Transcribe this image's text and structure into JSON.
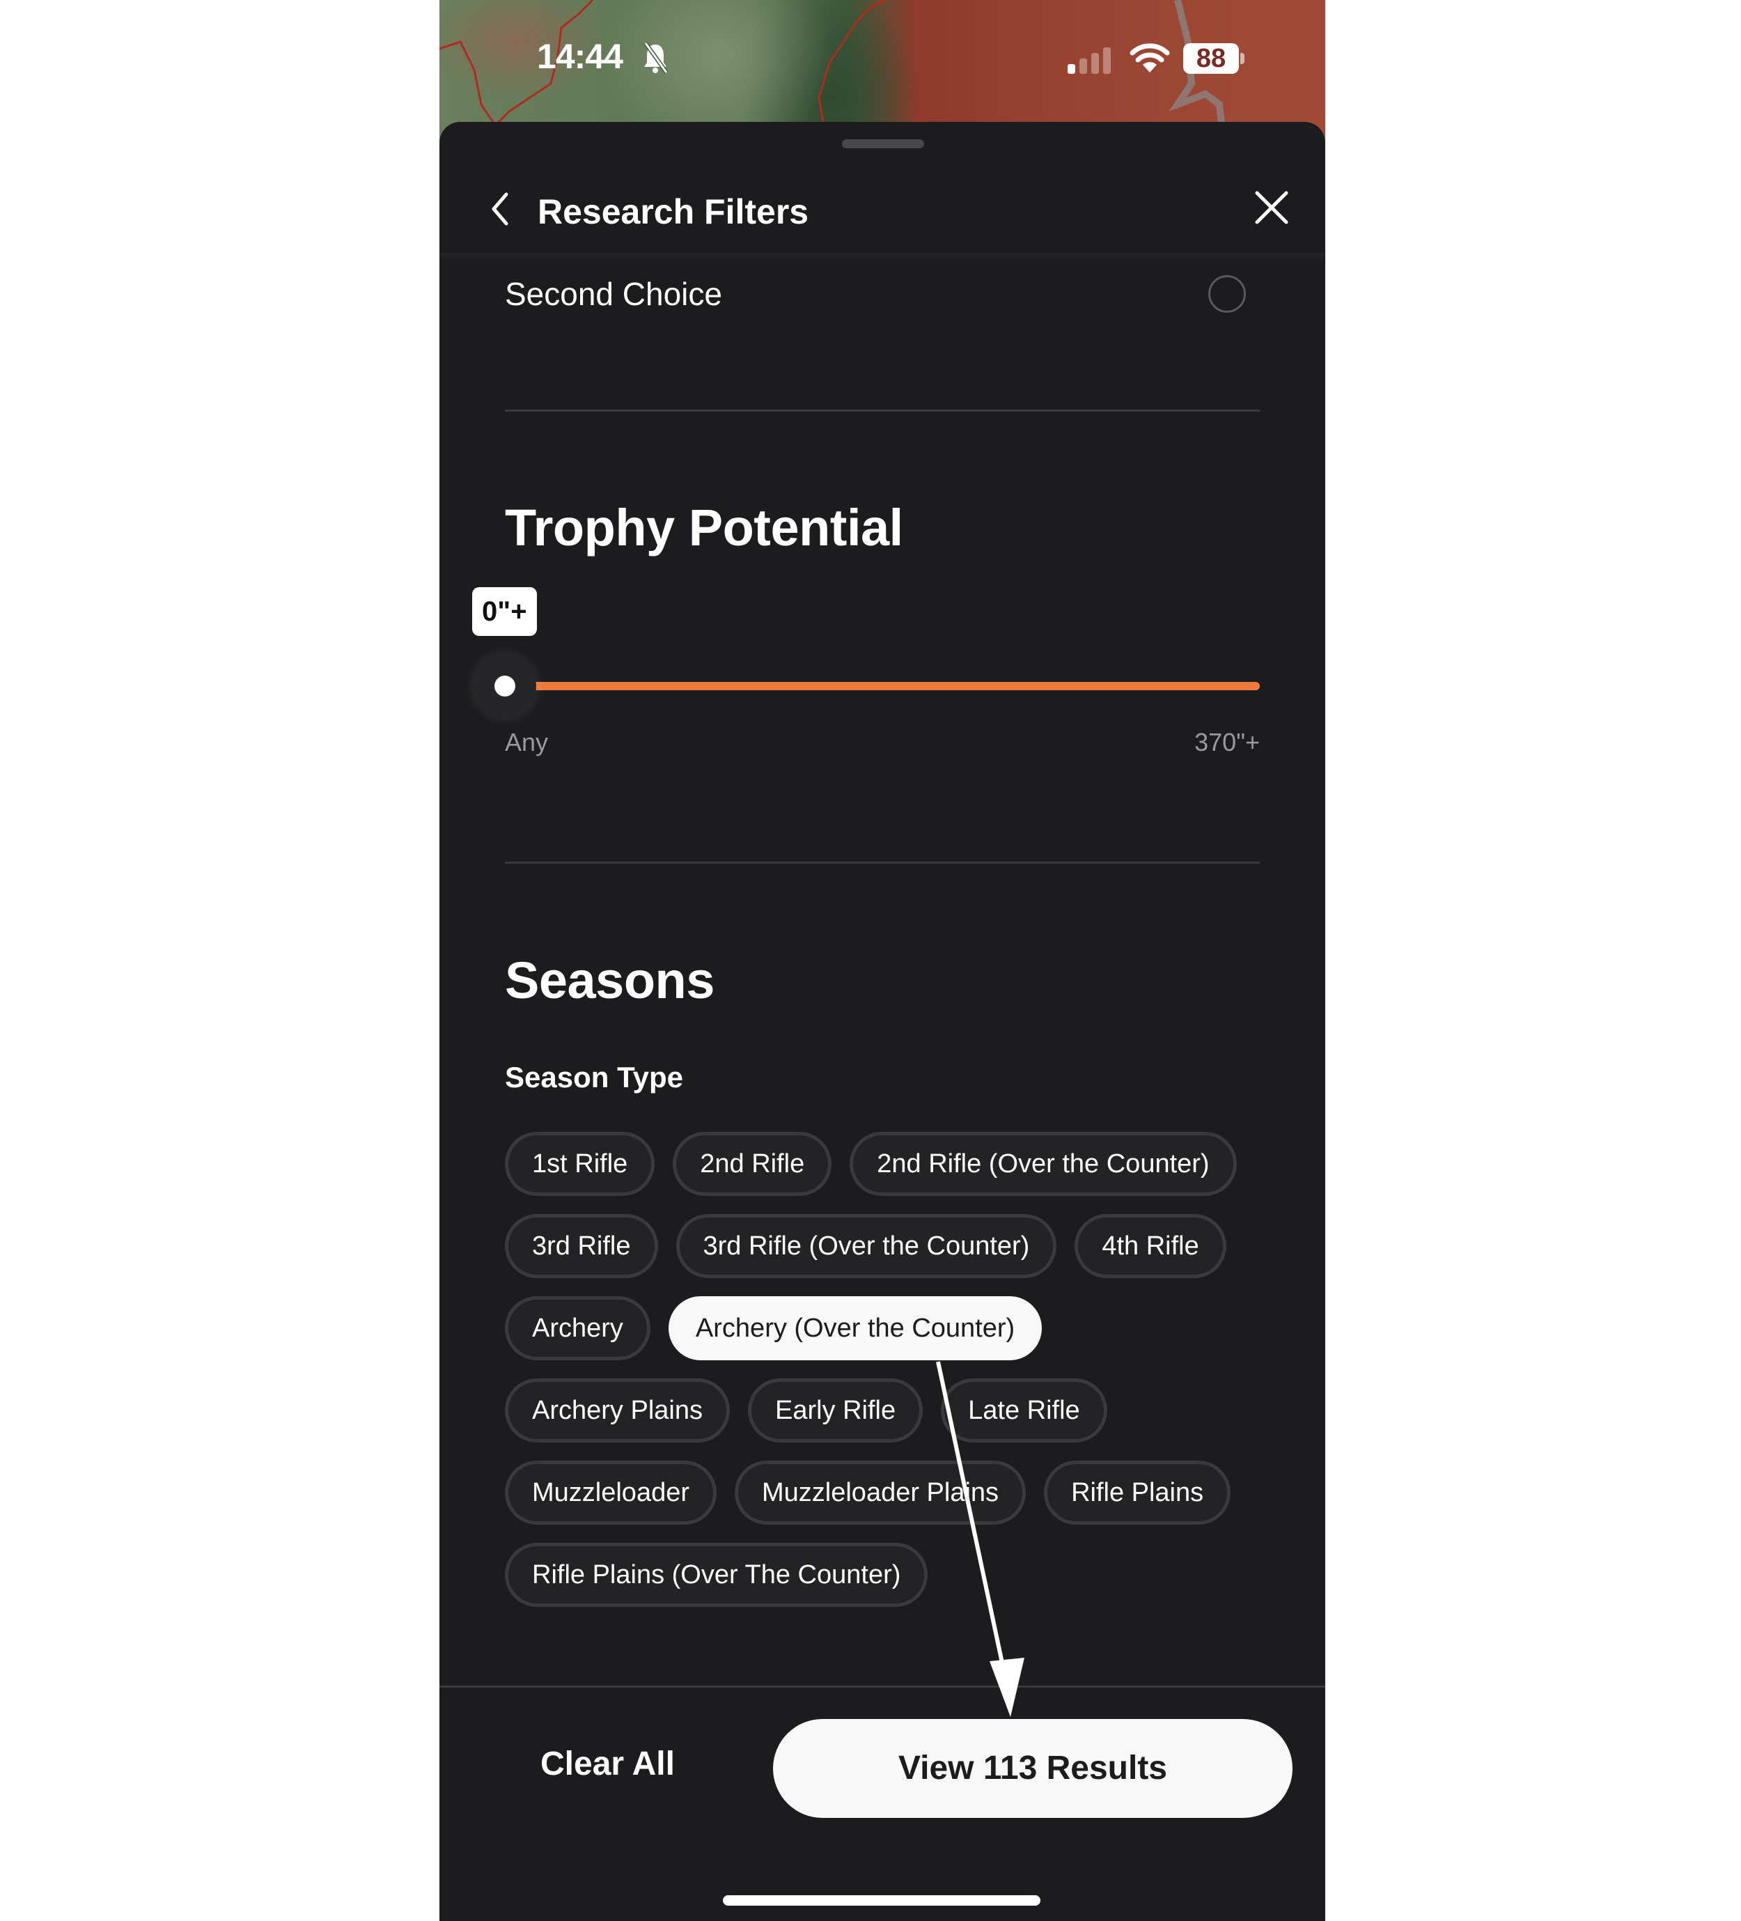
{
  "status_bar": {
    "time": "14:44",
    "silent_icon": "bell-slash-icon",
    "signal_icon": "cellular-signal-icon",
    "wifi_icon": "wifi-icon",
    "battery_level": "88"
  },
  "header": {
    "back_icon": "chevron-left-icon",
    "title": "Research Filters",
    "close_icon": "close-icon"
  },
  "second_choice": {
    "label": "Second Choice",
    "selected": false
  },
  "trophy": {
    "title": "Trophy Potential",
    "value_label": "0\"+",
    "value_fraction": 0,
    "min_label": "Any",
    "max_label": "370\"+",
    "accent_color": "#f07a3a"
  },
  "seasons": {
    "title": "Seasons",
    "season_type_label": "Season Type",
    "rows": [
      [
        {
          "label": "1st Rifle",
          "selected": false
        },
        {
          "label": "2nd Rifle",
          "selected": false
        },
        {
          "label": "2nd Rifle (Over the Counter)",
          "selected": false
        }
      ],
      [
        {
          "label": "3rd Rifle",
          "selected": false
        },
        {
          "label": "3rd Rifle (Over the Counter)",
          "selected": false
        },
        {
          "label": "4th Rifle",
          "selected": false
        }
      ],
      [
        {
          "label": "Archery",
          "selected": false
        },
        {
          "label": "Archery (Over the Counter)",
          "selected": true
        }
      ],
      [
        {
          "label": "Archery Plains",
          "selected": false
        },
        {
          "label": "Early Rifle",
          "selected": false
        },
        {
          "label": "Late Rifle",
          "selected": false
        }
      ],
      [
        {
          "label": "Muzzleloader",
          "selected": false
        },
        {
          "label": "Muzzleloader Plains",
          "selected": false
        },
        {
          "label": "Rifle Plains",
          "selected": false
        }
      ],
      [
        {
          "label": "Rifle Plains (Over The Counter)",
          "selected": false
        }
      ]
    ]
  },
  "footer": {
    "clear_label": "Clear All",
    "view_label": "View 113 Results"
  }
}
